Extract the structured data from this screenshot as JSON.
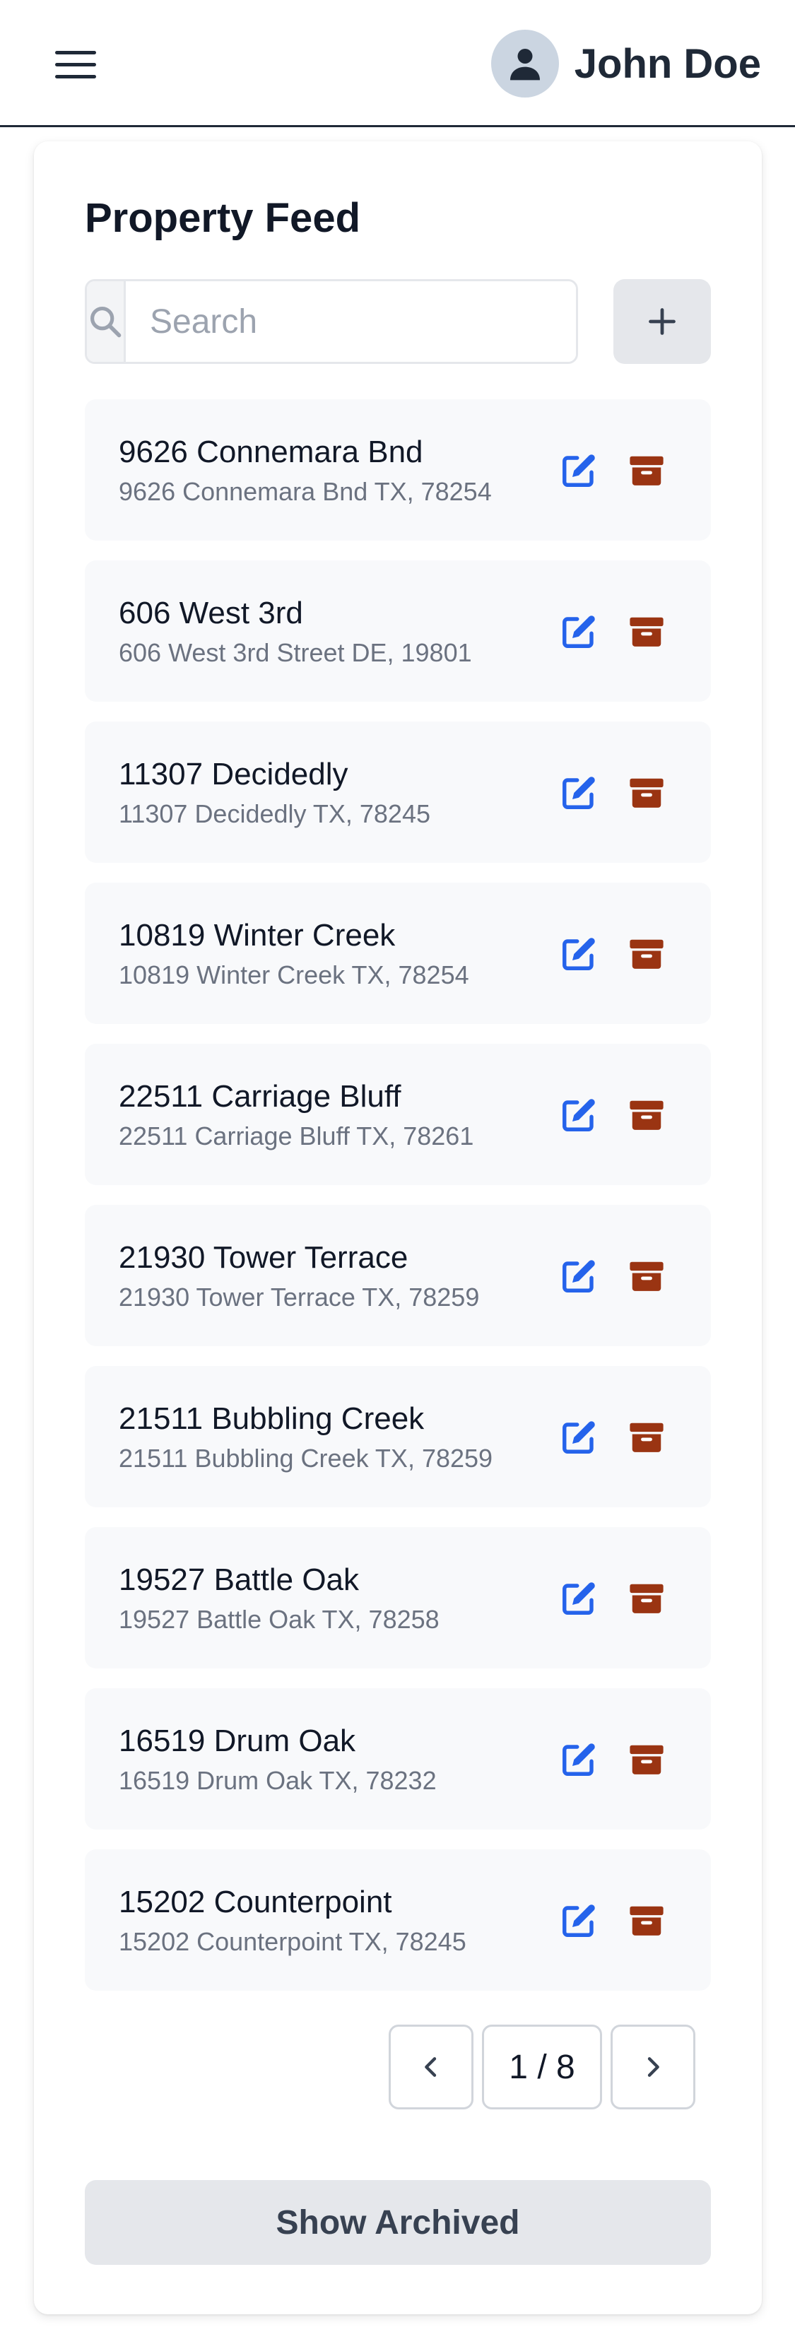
{
  "header": {
    "user_name": "John Doe",
    "menu_icon": "hamburger-menu-icon",
    "avatar_icon": "user-avatar-icon"
  },
  "feed": {
    "title": "Property Feed",
    "search": {
      "placeholder": "Search",
      "value": "",
      "icon": "search-icon"
    },
    "add_icon": "plus-icon",
    "items": [
      {
        "name": "9626 Connemara Bnd",
        "address": "9626 Connemara Bnd TX, 78254"
      },
      {
        "name": "606 West 3rd",
        "address": "606 West 3rd Street DE, 19801"
      },
      {
        "name": "11307 Decidedly",
        "address": "11307 Decidedly TX, 78245"
      },
      {
        "name": "10819 Winter Creek",
        "address": "10819 Winter Creek TX, 78254"
      },
      {
        "name": "22511 Carriage Bluff",
        "address": "22511 Carriage Bluff TX, 78261"
      },
      {
        "name": "21930 Tower Terrace",
        "address": "21930 Tower Terrace TX, 78259"
      },
      {
        "name": "21511 Bubbling Creek",
        "address": "21511 Bubbling Creek TX, 78259"
      },
      {
        "name": "19527 Battle Oak",
        "address": "19527 Battle Oak TX, 78258"
      },
      {
        "name": "16519 Drum Oak",
        "address": "16519 Drum Oak TX, 78232"
      },
      {
        "name": "15202 Counterpoint",
        "address": "15202 Counterpoint TX, 78245"
      }
    ],
    "item_icons": {
      "edit": "edit-icon",
      "archive": "archive-icon"
    },
    "pagination": {
      "status": "1 / 8",
      "prev_icon": "chevron-left-icon",
      "next_icon": "chevron-right-icon"
    },
    "show_archived_label": "Show Archived"
  },
  "colors": {
    "edit": "#2563eb",
    "archive": "#9a3412",
    "item_bg": "#f8f9fb",
    "button_bg": "#e5e7eb"
  }
}
